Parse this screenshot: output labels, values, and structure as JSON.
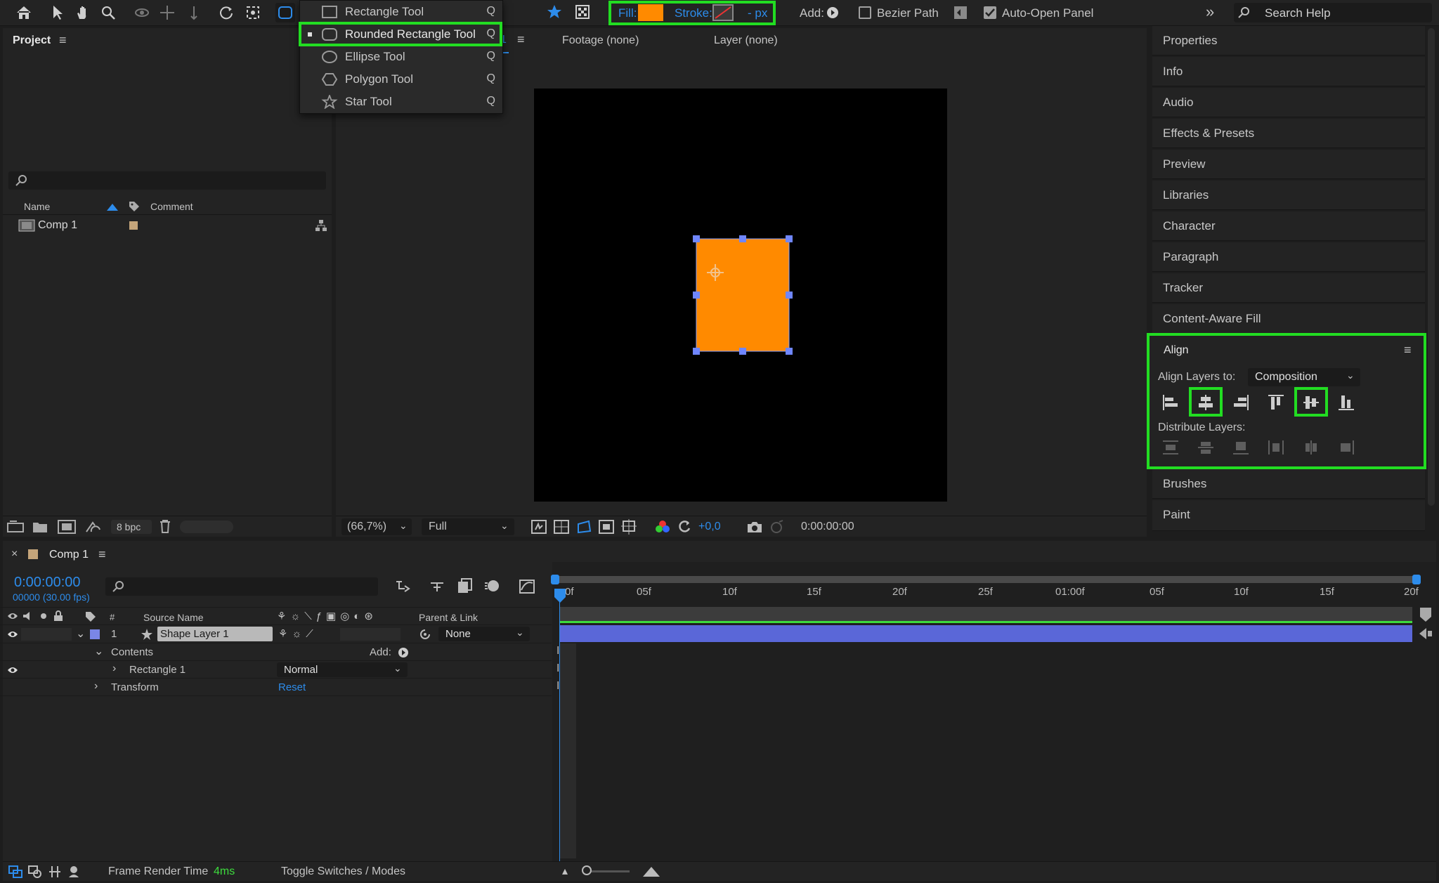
{
  "toolbar": {
    "menu_items": [
      {
        "label": "Rectangle Tool",
        "shortcut": "Q",
        "icon": "rectangle-icon"
      },
      {
        "label": "Rounded Rectangle Tool",
        "shortcut": "Q",
        "icon": "rounded-rectangle-icon",
        "selected": true
      },
      {
        "label": "Ellipse Tool",
        "shortcut": "Q",
        "icon": "ellipse-icon"
      },
      {
        "label": "Polygon Tool",
        "shortcut": "Q",
        "icon": "polygon-icon"
      },
      {
        "label": "Star Tool",
        "shortcut": "Q",
        "icon": "star-icon"
      }
    ],
    "fill_label": "Fill:",
    "stroke_label": "Stroke:",
    "stroke_px": "- px",
    "add_label": "Add:",
    "bezier_label": "Bezier Path",
    "auto_open_label": "Auto-Open Panel",
    "search_placeholder": "Search Help",
    "fill_color": "#ff8a00"
  },
  "project": {
    "title": "Project",
    "col_name": "Name",
    "col_comment": "Comment",
    "item_name": "Comp 1",
    "bpc": "8 bpc"
  },
  "viewer": {
    "tab_comp_suffix": "1",
    "tab_footage": "Footage (none)",
    "tab_layer": "Layer (none)",
    "zoom": "(66,7%)",
    "resolution": "Full",
    "exposure": "+0,0",
    "timecode": "0:00:00:00",
    "shape_color": "#ff8a00"
  },
  "right_panel": {
    "items": [
      "Properties",
      "Info",
      "Audio",
      "Effects & Presets",
      "Preview",
      "Libraries",
      "Character",
      "Paragraph",
      "Tracker",
      "Content-Aware Fill"
    ],
    "align_title": "Align",
    "align_to_label": "Align Layers to:",
    "align_to_value": "Composition",
    "distribute_label": "Distribute Layers:",
    "items_after": [
      "Brushes",
      "Paint"
    ]
  },
  "timeline": {
    "tab_name": "Comp 1",
    "timecode": "0:00:00:00",
    "fps_label": "00000 (30.00 fps)",
    "col_num": "#",
    "col_source": "Source Name",
    "col_parent": "Parent & Link",
    "layer_num": "1",
    "layer_name": "Shape Layer 1",
    "parent_value": "None",
    "contents_label": "Contents",
    "add_label": "Add:",
    "rect_label": "Rectangle 1",
    "blend_mode": "Normal",
    "transform_label": "Transform",
    "reset_label": "Reset",
    "ruler": [
      "0f",
      "05f",
      "10f",
      "15f",
      "20f",
      "25f",
      "01:00f",
      "05f",
      "10f",
      "15f",
      "20f"
    ],
    "render_label": "Frame Render Time",
    "render_value": "4ms",
    "toggle_label": "Toggle Switches / Modes"
  },
  "colors": {
    "accent": "#2d8ceb",
    "highlight": "#22dd22",
    "layer_bar": "#5a67d8",
    "layer_label": "#7a86e6"
  }
}
